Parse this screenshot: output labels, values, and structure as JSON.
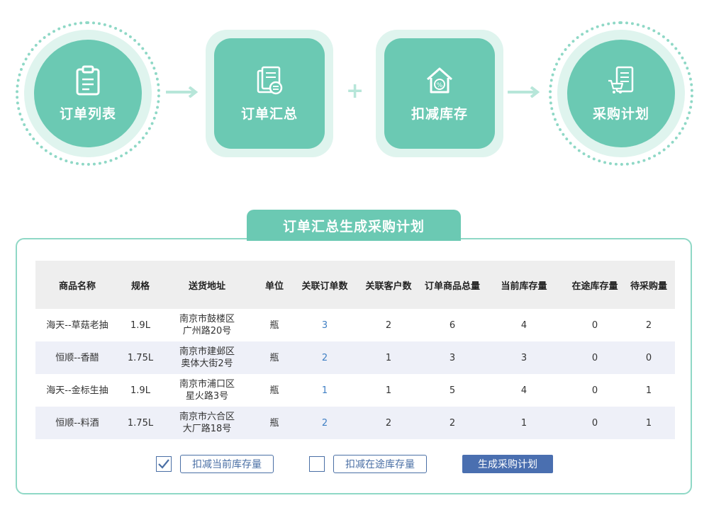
{
  "flow": {
    "steps": [
      {
        "label": "订单列表",
        "icon": "clipboard-icon"
      },
      {
        "label": "订单汇总",
        "icon": "document-exchange-icon"
      },
      {
        "label": "扣减库存",
        "icon": "warehouse-discount-icon"
      },
      {
        "label": "采购计划",
        "icon": "cart-list-icon"
      }
    ],
    "plus": "+"
  },
  "panel": {
    "title": "订单汇总生成采购计划",
    "table": {
      "headers": [
        "商品名称",
        "规格",
        "送货地址",
        "单位",
        "关联订单数",
        "关联客户数",
        "订单商品总量",
        "当前库存量",
        "在途库存量",
        "待采购量"
      ],
      "rows": [
        {
          "name": "海天--草菇老抽",
          "spec": "1.9L",
          "addr1": "南京市鼓楼区",
          "addr2": "广州路20号",
          "unit": "瓶",
          "orders": "3",
          "customers": "2",
          "total": "6",
          "stock": "4",
          "transit": "0",
          "purchase": "2"
        },
        {
          "name": "恒顺--香醋",
          "spec": "1.75L",
          "addr1": "南京市建邺区",
          "addr2": "奥体大街2号",
          "unit": "瓶",
          "orders": "2",
          "customers": "1",
          "total": "3",
          "stock": "3",
          "transit": "0",
          "purchase": "0"
        },
        {
          "name": "海天--金标生抽",
          "spec": "1.9L",
          "addr1": "南京市浦口区",
          "addr2": "星火路3号",
          "unit": "瓶",
          "orders": "1",
          "customers": "1",
          "total": "5",
          "stock": "4",
          "transit": "0",
          "purchase": "1"
        },
        {
          "name": "恒顺--料酒",
          "spec": "1.75L",
          "addr1": "南京市六合区",
          "addr2": "大厂路18号",
          "unit": "瓶",
          "orders": "2",
          "customers": "2",
          "total": "2",
          "stock": "1",
          "transit": "0",
          "purchase": "1"
        }
      ]
    },
    "options": {
      "deduct_current": {
        "label": "扣减当前库存量",
        "checked": true
      },
      "deduct_transit": {
        "label": "扣减在途库存量",
        "checked": false
      }
    },
    "generate_label": "生成采购计划"
  },
  "colors": {
    "accent": "#6bc9b3",
    "halo": "#dff4ee",
    "button": "#4a6fb0",
    "link": "#3f7fc4"
  }
}
